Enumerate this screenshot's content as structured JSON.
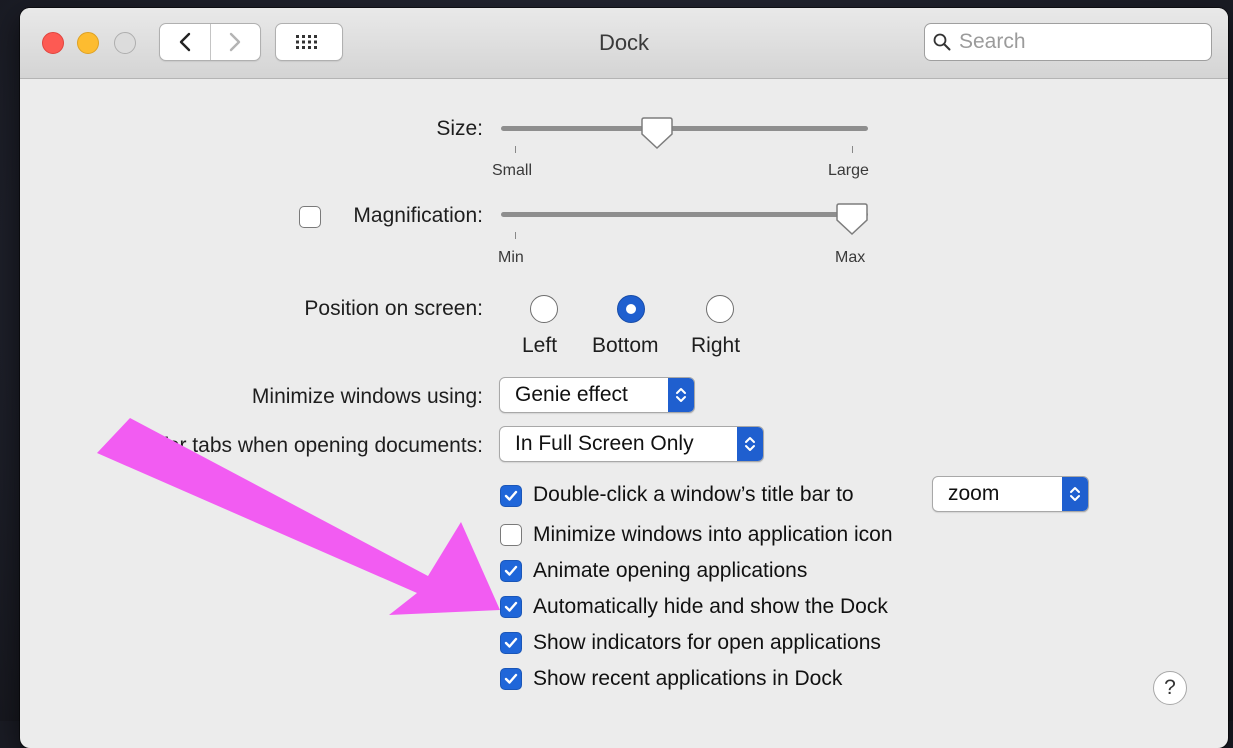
{
  "window": {
    "title": "Dock"
  },
  "toolbar": {
    "search_placeholder": "Search"
  },
  "size": {
    "label": "Size:",
    "min_label": "Small",
    "max_label": "Large",
    "value": 0.42
  },
  "magnification": {
    "label": "Magnification:",
    "checked": false,
    "min_label": "Min",
    "max_label": "Max",
    "value": 1.0
  },
  "position": {
    "label": "Position on screen:",
    "options": [
      {
        "label": "Left",
        "selected": false
      },
      {
        "label": "Bottom",
        "selected": true
      },
      {
        "label": "Right",
        "selected": false
      }
    ]
  },
  "minimize": {
    "label": "Minimize windows using:",
    "value": "Genie effect"
  },
  "prefer_tabs": {
    "label": "Prefer tabs when opening documents:",
    "value": "In Full Screen Only"
  },
  "checkboxes": [
    {
      "label": "Double-click a window’s title bar to",
      "checked": true,
      "popup_value": "zoom"
    },
    {
      "label": "Minimize windows into application icon",
      "checked": false
    },
    {
      "label": "Animate opening applications",
      "checked": true
    },
    {
      "label": "Automatically hide and show the Dock",
      "checked": true
    },
    {
      "label": "Show indicators for open applications",
      "checked": true
    },
    {
      "label": "Show recent applications in Dock",
      "checked": true
    }
  ],
  "help": {
    "label": "?"
  },
  "colors": {
    "accent": "#1f5fcf",
    "annotation_arrow": "#f25cf2"
  }
}
